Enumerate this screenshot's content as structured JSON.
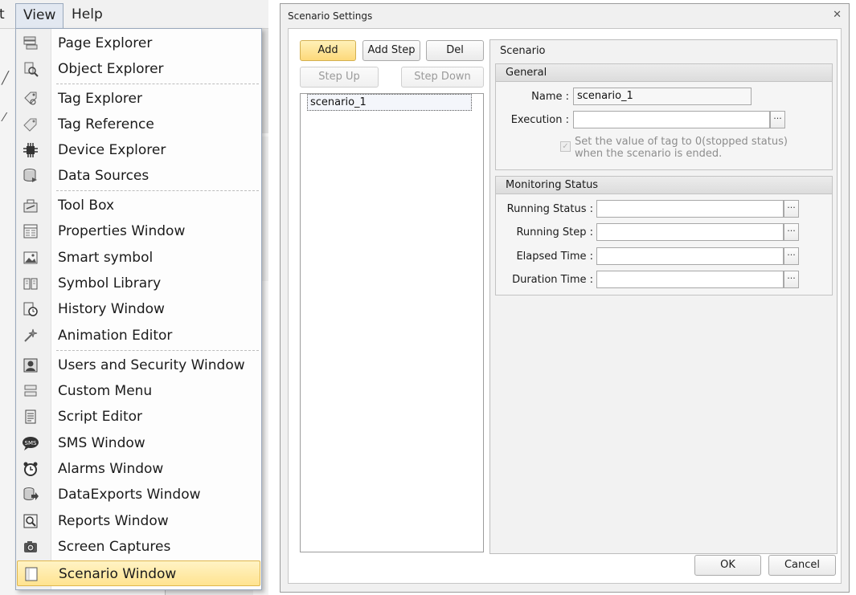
{
  "menubar": {
    "prev_label": "t",
    "view_label": "View",
    "help_label": "Help"
  },
  "view_menu": {
    "items": [
      {
        "label": "Page Explorer",
        "icon": "page-explorer-icon"
      },
      {
        "label": "Object Explorer",
        "icon": "object-explorer-icon"
      },
      {
        "label": "Tag Explorer",
        "icon": "tag-explorer-icon"
      },
      {
        "label": "Tag Reference",
        "icon": "tag-reference-icon"
      },
      {
        "label": "Device Explorer",
        "icon": "device-explorer-icon"
      },
      {
        "label": "Data Sources",
        "icon": "data-sources-icon"
      },
      {
        "label": "Tool Box",
        "icon": "tool-box-icon"
      },
      {
        "label": "Properties Window",
        "icon": "properties-window-icon"
      },
      {
        "label": "Smart symbol",
        "icon": "smart-symbol-icon"
      },
      {
        "label": "Symbol Library",
        "icon": "symbol-library-icon"
      },
      {
        "label": "History Window",
        "icon": "history-window-icon"
      },
      {
        "label": "Animation Editor",
        "icon": "animation-editor-icon"
      },
      {
        "label": "Users and Security Window",
        "icon": "users-security-icon"
      },
      {
        "label": "Custom Menu",
        "icon": "custom-menu-icon"
      },
      {
        "label": "Script Editor",
        "icon": "script-editor-icon"
      },
      {
        "label": "SMS Window",
        "icon": "sms-window-icon",
        "icon_text": "SMS"
      },
      {
        "label": "Alarms Window",
        "icon": "alarms-window-icon"
      },
      {
        "label": "DataExports Window",
        "icon": "data-exports-icon"
      },
      {
        "label": "Reports Window",
        "icon": "reports-window-icon"
      },
      {
        "label": "Screen Captures",
        "icon": "screen-captures-icon"
      },
      {
        "label": "Scenario Window",
        "icon": "scenario-window-icon"
      }
    ],
    "highlighted": "Scenario Window"
  },
  "dialog": {
    "title": "Scenario Settings",
    "close_glyph": "✕",
    "buttons": {
      "add": "Add",
      "add_step": "Add Step",
      "del": "Del",
      "step_up": "Step Up",
      "step_down": "Step Down"
    },
    "scenario_list": [
      "scenario_1"
    ],
    "panel_title": "Scenario",
    "general": {
      "header": "General",
      "name_label": "Name :",
      "name_value": "scenario_1",
      "execution_label": "Execution :",
      "execution_value": "",
      "checkbox_line1": "Set the value of tag to 0(stopped status)",
      "checkbox_line2": "when the scenario is ended.",
      "checkbox_checked": true
    },
    "monitoring": {
      "header": "Monitoring Status",
      "running_status_label": "Running Status :",
      "running_step_label": "Running Step :",
      "elapsed_time_label": "Elapsed Time :",
      "duration_time_label": "Duration Time :"
    },
    "ellipsis": "···",
    "ok_label": "OK",
    "cancel_label": "Cancel"
  },
  "colors": {
    "accent_yellow": "#fdd97a",
    "menu_border": "#9aa9bd",
    "group_header": "#dcdcdc"
  }
}
